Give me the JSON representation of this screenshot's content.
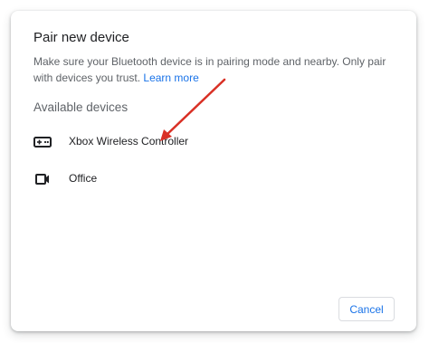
{
  "dialog": {
    "title": "Pair new device",
    "description": "Make sure your Bluetooth device is in pairing mode and nearby. Only pair with devices you trust.",
    "learn_more": "Learn more",
    "section_heading": "Available devices",
    "devices": [
      {
        "label": "Xbox Wireless Controller",
        "icon": "gamepad-icon"
      },
      {
        "label": "Office",
        "icon": "video-camera-icon"
      }
    ],
    "cancel_label": "Cancel"
  },
  "annotation": {
    "arrow_color": "#d93025"
  },
  "colors": {
    "accent": "#1a73e8",
    "text": "#202124",
    "secondary_text": "#5f6368"
  }
}
